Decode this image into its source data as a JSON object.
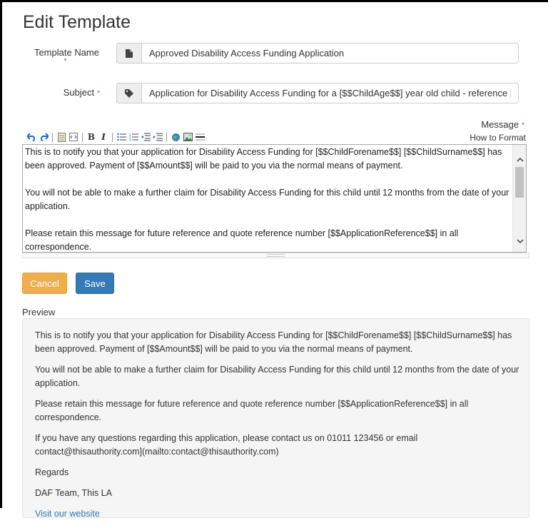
{
  "page": {
    "title": "Edit Template"
  },
  "form": {
    "template_name_label": "Template Name",
    "template_name_required": "*",
    "template_name_value": "Approved Disability Access Funding Application",
    "subject_label": "Subject",
    "subject_required": "*",
    "subject_value": "Application for Disability Access Funding for a [$$ChildAge$$] year old child - reference [$$ApplicationReference$$]",
    "message_label": "Message",
    "message_required": "*",
    "how_to_format": "How to Format"
  },
  "toolbar": {
    "icons": [
      "undo-icon",
      "redo-icon",
      "notepad-icon",
      "source-icon",
      "bold-icon",
      "italic-icon",
      "bullet-list-icon",
      "numbered-list-icon",
      "outdent-icon",
      "indent-icon",
      "link-icon",
      "image-icon",
      "horizontal-rule-icon"
    ],
    "bold_glyph": "B",
    "italic_glyph": "I"
  },
  "editor": {
    "paragraphs": [
      "This is to notify you that your application for Disability Access Funding for [$$ChildForename$$] [$$ChildSurname$$] has been approved. Payment of [$$Amount$$] will be paid to you via the normal means of payment.",
      "You will not be able to make a further claim for Disability Access Funding for this child until 12 months from the date of your application.",
      "Please retain this message for future reference and quote reference number [$$ApplicationReference$$] in all correspondence."
    ]
  },
  "buttons": {
    "cancel": "Cancel",
    "save": "Save"
  },
  "preview": {
    "label": "Preview",
    "paragraphs": [
      "This is to notify you that your application for Disability Access Funding for [$$ChildForename$$] [$$ChildSurname$$] has been approved. Payment of [$$Amount$$] will be paid to you via the normal means of payment.",
      "You will not be able to make a further claim for Disability Access Funding for this child until 12 months from the date of your application.",
      "Please retain this message for future reference and quote reference number [$$ApplicationReference$$] in all correspondence.",
      "If you have any questions regarding this application, please contact us on 01011 123456 or email contact@thisauthority.com](mailto:contact@thisauthority.com)",
      "Regards",
      "DAF Team, This LA"
    ],
    "link_text": "Visit our website"
  },
  "colors": {
    "cancel": "#f0ad4e",
    "save": "#337ab7",
    "required": "#d9534f",
    "link": "#337ab7"
  }
}
